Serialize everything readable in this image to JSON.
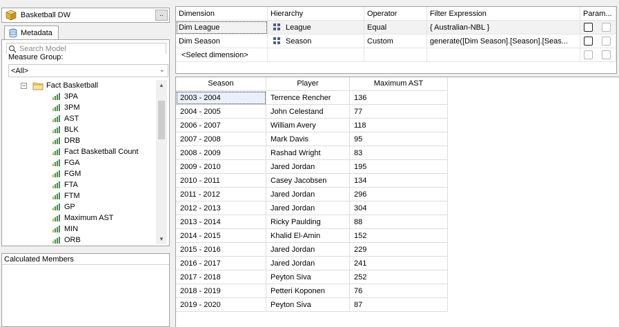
{
  "cube": {
    "name": "Basketball DW",
    "browse_label": ".."
  },
  "metadata_tab": {
    "label": "Metadata"
  },
  "search": {
    "placeholder": "Search Model"
  },
  "measure_group": {
    "label": "Measure Group:",
    "value": "<All>"
  },
  "tree": {
    "folder": "Fact Basketball",
    "measures": [
      "3PA",
      "3PM",
      "AST",
      "BLK",
      "DRB",
      "Fact Basketball Count",
      "FGA",
      "FGM",
      "FTA",
      "FTM",
      "GP",
      "Maximum AST",
      "MIN",
      "ORB"
    ]
  },
  "calculated_members": {
    "title": "Calculated Members"
  },
  "filter": {
    "headers": {
      "dimension": "Dimension",
      "hierarchy": "Hierarchy",
      "operator": "Operator",
      "expression": "Filter Expression",
      "params": "Param..."
    },
    "rows": [
      {
        "dimension": "Dim League",
        "hierarchy": "League",
        "operator": "Equal",
        "expression": "{ Australian-NBL }"
      },
      {
        "dimension": "Dim Season",
        "hierarchy": "Season",
        "operator": "Custom",
        "expression": "generate([Dim Season].[Season].[Seas..."
      }
    ],
    "select_placeholder": "<Select dimension>"
  },
  "results": {
    "headers": {
      "season": "Season",
      "player": "Player",
      "max_ast": "Maximum AST"
    },
    "rows": [
      {
        "season": "2003 - 2004",
        "player": "Terrence Rencher",
        "max_ast": "136"
      },
      {
        "season": "2004 - 2005",
        "player": "John Celestand",
        "max_ast": "77"
      },
      {
        "season": "2006 - 2007",
        "player": "William Avery",
        "max_ast": "118"
      },
      {
        "season": "2007 - 2008",
        "player": "Mark Davis",
        "max_ast": "95"
      },
      {
        "season": "2008 - 2009",
        "player": "Rashad Wright",
        "max_ast": "83"
      },
      {
        "season": "2009 - 2010",
        "player": "Jared Jordan",
        "max_ast": "195"
      },
      {
        "season": "2010 - 2011",
        "player": "Casey Jacobsen",
        "max_ast": "134"
      },
      {
        "season": "2011 - 2012",
        "player": "Jared Jordan",
        "max_ast": "296"
      },
      {
        "season": "2012 - 2013",
        "player": "Jared Jordan",
        "max_ast": "304"
      },
      {
        "season": "2013 - 2014",
        "player": "Ricky Paulding",
        "max_ast": "88"
      },
      {
        "season": "2014 - 2015",
        "player": "Khalid El-Amin",
        "max_ast": "152"
      },
      {
        "season": "2015 - 2016",
        "player": "Jared Jordan",
        "max_ast": "229"
      },
      {
        "season": "2016 - 2017",
        "player": "Jared Jordan",
        "max_ast": "241"
      },
      {
        "season": "2017 - 2018",
        "player": "Peyton Siva",
        "max_ast": "252"
      },
      {
        "season": "2018 - 2019",
        "player": "Petteri Koponen",
        "max_ast": "76"
      },
      {
        "season": "2019 - 2020",
        "player": "Peyton Siva",
        "max_ast": "87"
      }
    ]
  }
}
